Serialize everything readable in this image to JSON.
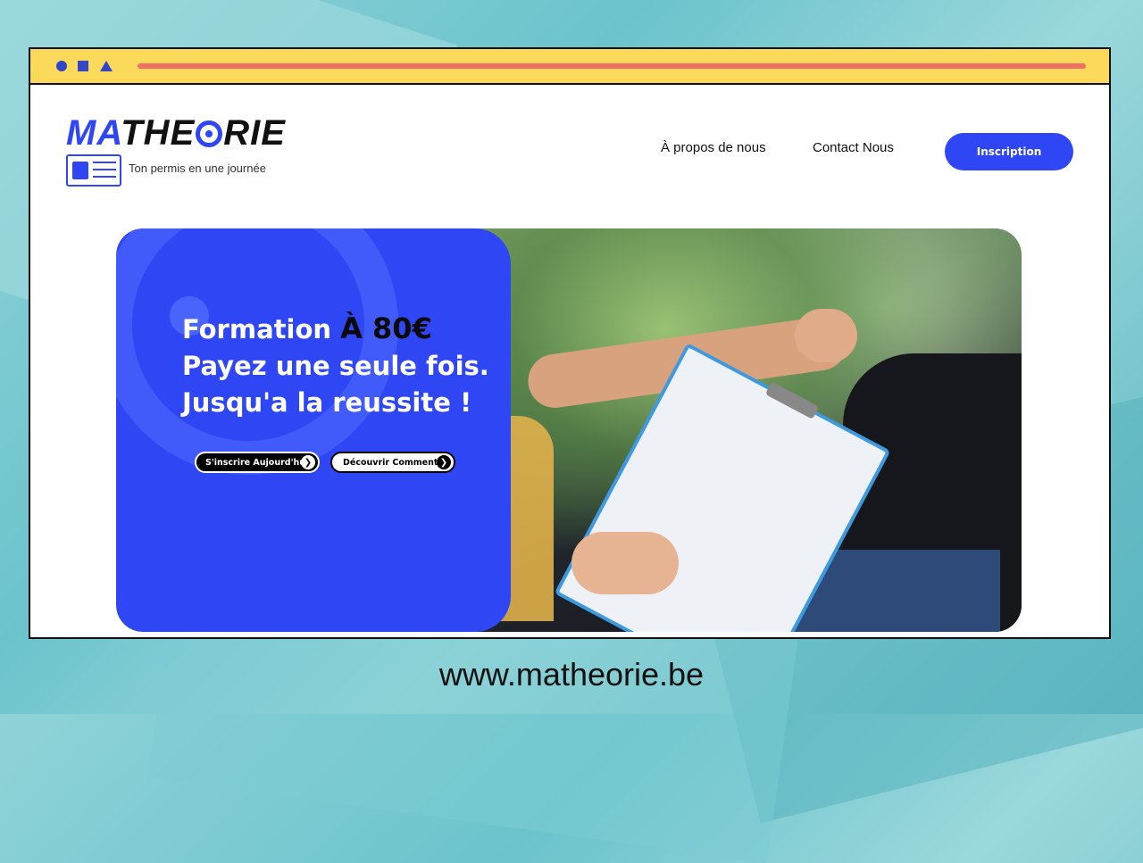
{
  "brand": {
    "logo_ma": "MA",
    "logo_the": "THE",
    "logo_rie": "RIE",
    "tagline": "Ton permis en une journée",
    "accent_color": "#2f46f5"
  },
  "nav": {
    "about": "À propos de nous",
    "contact": "Contact Nous",
    "signup": "Inscription"
  },
  "hero": {
    "line1_prefix": "Formation ",
    "line1_price": "À 80€",
    "line2": "Payez une seule fois.",
    "line3": "Jusqu'a la reussite !",
    "cta_primary": "S'inscrire Aujourd'hui",
    "cta_secondary": "Découvrir Comment",
    "arrow_glyph": "❯"
  },
  "footer": {
    "url": "www.matheorie.be"
  }
}
